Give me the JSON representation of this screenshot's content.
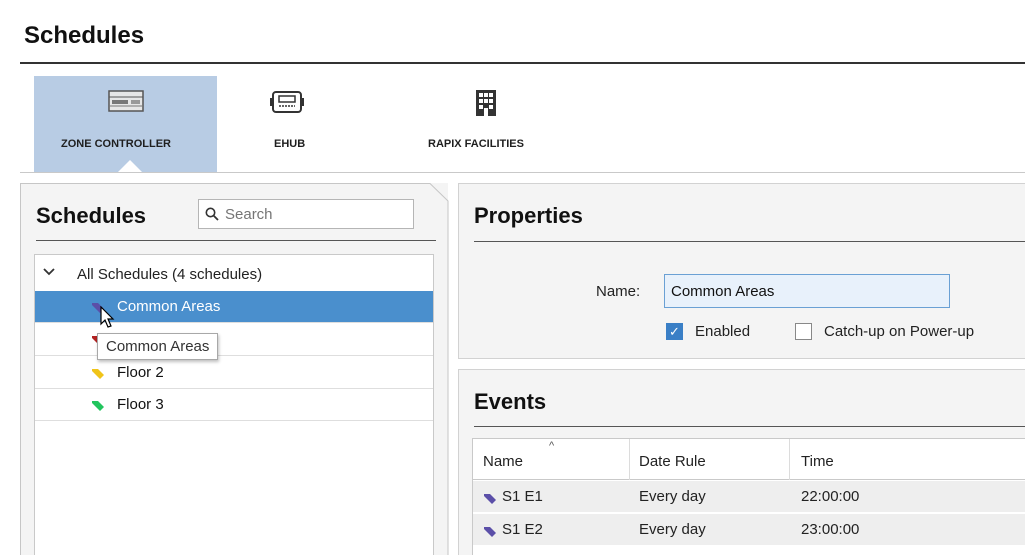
{
  "page_title": "Schedules",
  "tabs": [
    {
      "label": "ZONE CONTROLLER",
      "icon": "zone-controller-icon",
      "active": true
    },
    {
      "label": "EHUB",
      "icon": "ehub-icon",
      "active": false
    },
    {
      "label": "RAPIX FACILITIES",
      "icon": "building-icon",
      "active": false
    }
  ],
  "schedules_panel": {
    "heading": "Schedules",
    "search_placeholder": "Search",
    "root_label": "All Schedules (4 schedules)",
    "items": [
      {
        "label": "Common Areas",
        "color": "#5b4fa8",
        "selected": true
      },
      {
        "label": "",
        "color": "#b22222",
        "selected": false
      },
      {
        "label": "Floor 2",
        "color": "#f0c419",
        "selected": false
      },
      {
        "label": "Floor 3",
        "color": "#22c55e",
        "selected": false
      }
    ],
    "tooltip": "Common Areas"
  },
  "properties": {
    "heading": "Properties",
    "name_label": "Name:",
    "name_value": "Common Areas",
    "enabled_label": "Enabled",
    "enabled_checked": true,
    "catchup_label": "Catch-up on Power-up",
    "catchup_checked": false
  },
  "events": {
    "heading": "Events",
    "columns": [
      "Name",
      "Date Rule",
      "Time"
    ],
    "rows": [
      {
        "name": "S1 E1",
        "date_rule": "Every day",
        "time": "22:00:00"
      },
      {
        "name": "S1 E2",
        "date_rule": "Every day",
        "time": "23:00:00"
      }
    ]
  },
  "colors": {
    "accent": "#4a8fcd",
    "active_tab": "#b8cce4",
    "tag_purple": "#5b4fa8"
  }
}
